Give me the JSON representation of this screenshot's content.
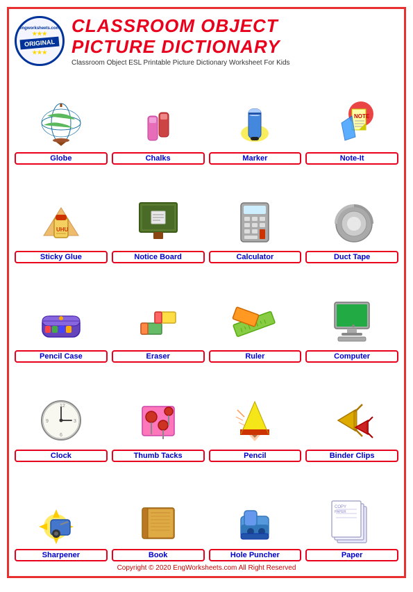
{
  "page": {
    "border_color": "#e8001c",
    "title_line1": "CLASSROOM OBJECT",
    "title_line2": "PICTURE DICTIONARY",
    "subtitle": "Classroom Object ESL Printable Picture Dictionary Worksheet For Kids",
    "footer": "Copyright © 2020 EngWorksheets.com All Right Reserved",
    "logo": {
      "top_text": "engworksheets.com",
      "stamp_text": "ORIGINAL",
      "stars": "★★★★★"
    }
  },
  "items": [
    {
      "id": "globe",
      "label": "Globe",
      "emoji": "🌍"
    },
    {
      "id": "chalks",
      "label": "Chalks",
      "emoji": "🖊️"
    },
    {
      "id": "marker",
      "label": "Marker",
      "emoji": "🖊️"
    },
    {
      "id": "noteit",
      "label": "Note-It",
      "emoji": "📝"
    },
    {
      "id": "stickyglue",
      "label": "Sticky Glue",
      "emoji": "📐"
    },
    {
      "id": "noticeboard",
      "label": "Notice Board",
      "emoji": "📋"
    },
    {
      "id": "calculator",
      "label": "Calculator",
      "emoji": "🧮"
    },
    {
      "id": "ducttape",
      "label": "Duct Tape",
      "emoji": "🪣"
    },
    {
      "id": "pencilcase",
      "label": "Pencil Case",
      "emoji": "👜"
    },
    {
      "id": "eraser",
      "label": "Eraser",
      "emoji": "🧹"
    },
    {
      "id": "ruler",
      "label": "Ruler",
      "emoji": "📏"
    },
    {
      "id": "computer",
      "label": "Computer",
      "emoji": "💻"
    },
    {
      "id": "clock",
      "label": "Clock",
      "emoji": "🕐"
    },
    {
      "id": "thumbtacks",
      "label": "Thumb Tacks",
      "emoji": "📌"
    },
    {
      "id": "pencil",
      "label": "Pencil",
      "emoji": "✏️"
    },
    {
      "id": "binderclips",
      "label": "Binder Clips",
      "emoji": "🖇️"
    },
    {
      "id": "sharpener",
      "label": "Sharpener",
      "emoji": "✂️"
    },
    {
      "id": "book",
      "label": "Book",
      "emoji": "📚"
    },
    {
      "id": "holepuncher",
      "label": "Hole Puncher",
      "emoji": "📎"
    },
    {
      "id": "paper",
      "label": "Paper",
      "emoji": "📄"
    }
  ]
}
